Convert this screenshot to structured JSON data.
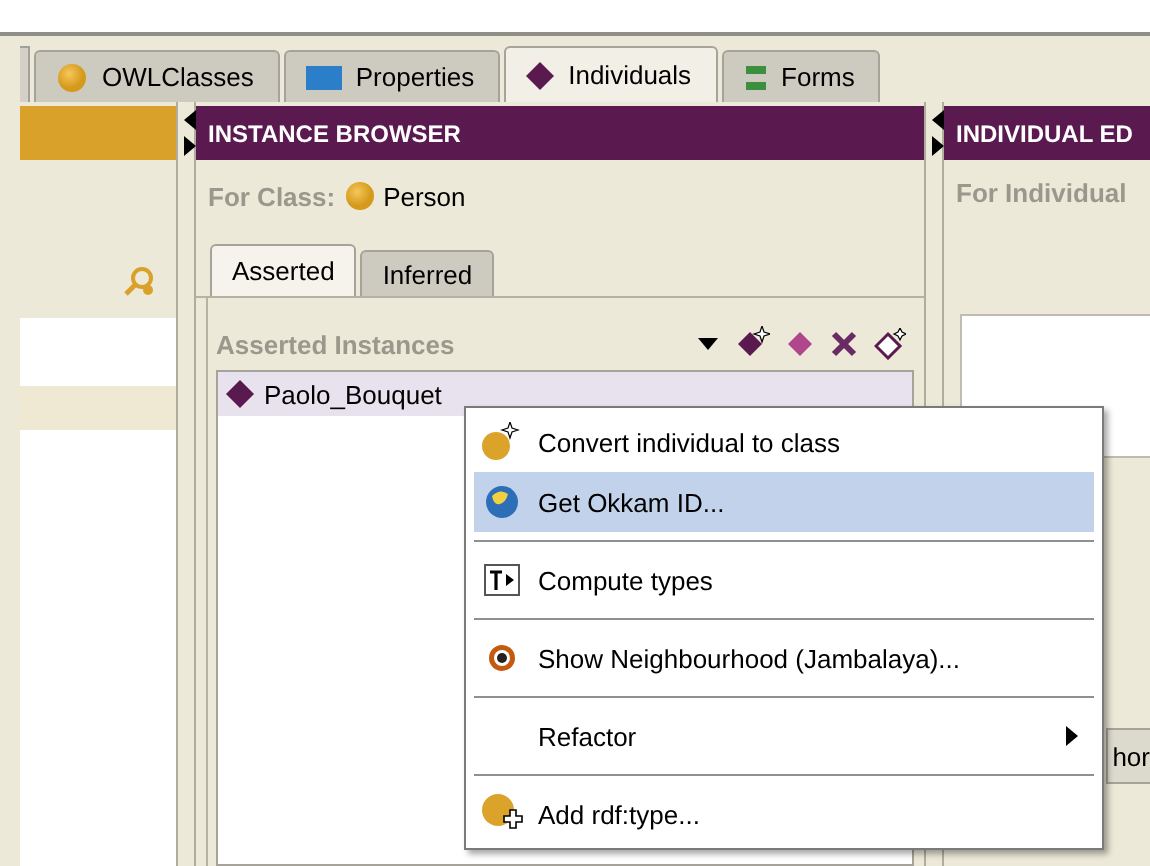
{
  "tabs": [
    {
      "label": "OWLClasses",
      "selected": false
    },
    {
      "label": "Properties",
      "selected": false
    },
    {
      "label": "Individuals",
      "selected": true
    },
    {
      "label": "Forms",
      "selected": false
    }
  ],
  "instance_browser": {
    "title": "INSTANCE BROWSER",
    "for_class_label": "For Class:",
    "class_name": "Person",
    "subtabs": [
      {
        "label": "Asserted",
        "selected": true
      },
      {
        "label": "Inferred",
        "selected": false
      }
    ],
    "list_title": "Asserted Instances",
    "instances": [
      {
        "name": "Paolo_Bouquet",
        "selected": true
      }
    ]
  },
  "individual_editor": {
    "title": "INDIVIDUAL ED",
    "for_individual_label": "For Individual",
    "button_fragment": "hor"
  },
  "context_menu": [
    {
      "kind": "item",
      "label": "Convert individual to class",
      "selected": false
    },
    {
      "kind": "item",
      "label": "Get Okkam ID...",
      "selected": true
    },
    {
      "kind": "separator"
    },
    {
      "kind": "item",
      "label": "Compute types",
      "selected": false
    },
    {
      "kind": "separator"
    },
    {
      "kind": "item",
      "label": "Show Neighbourhood (Jambalaya)...",
      "selected": false
    },
    {
      "kind": "separator"
    },
    {
      "kind": "submenu",
      "label": "Refactor",
      "selected": false
    },
    {
      "kind": "separator"
    },
    {
      "kind": "item",
      "label": "Add rdf:type...",
      "selected": false
    }
  ]
}
